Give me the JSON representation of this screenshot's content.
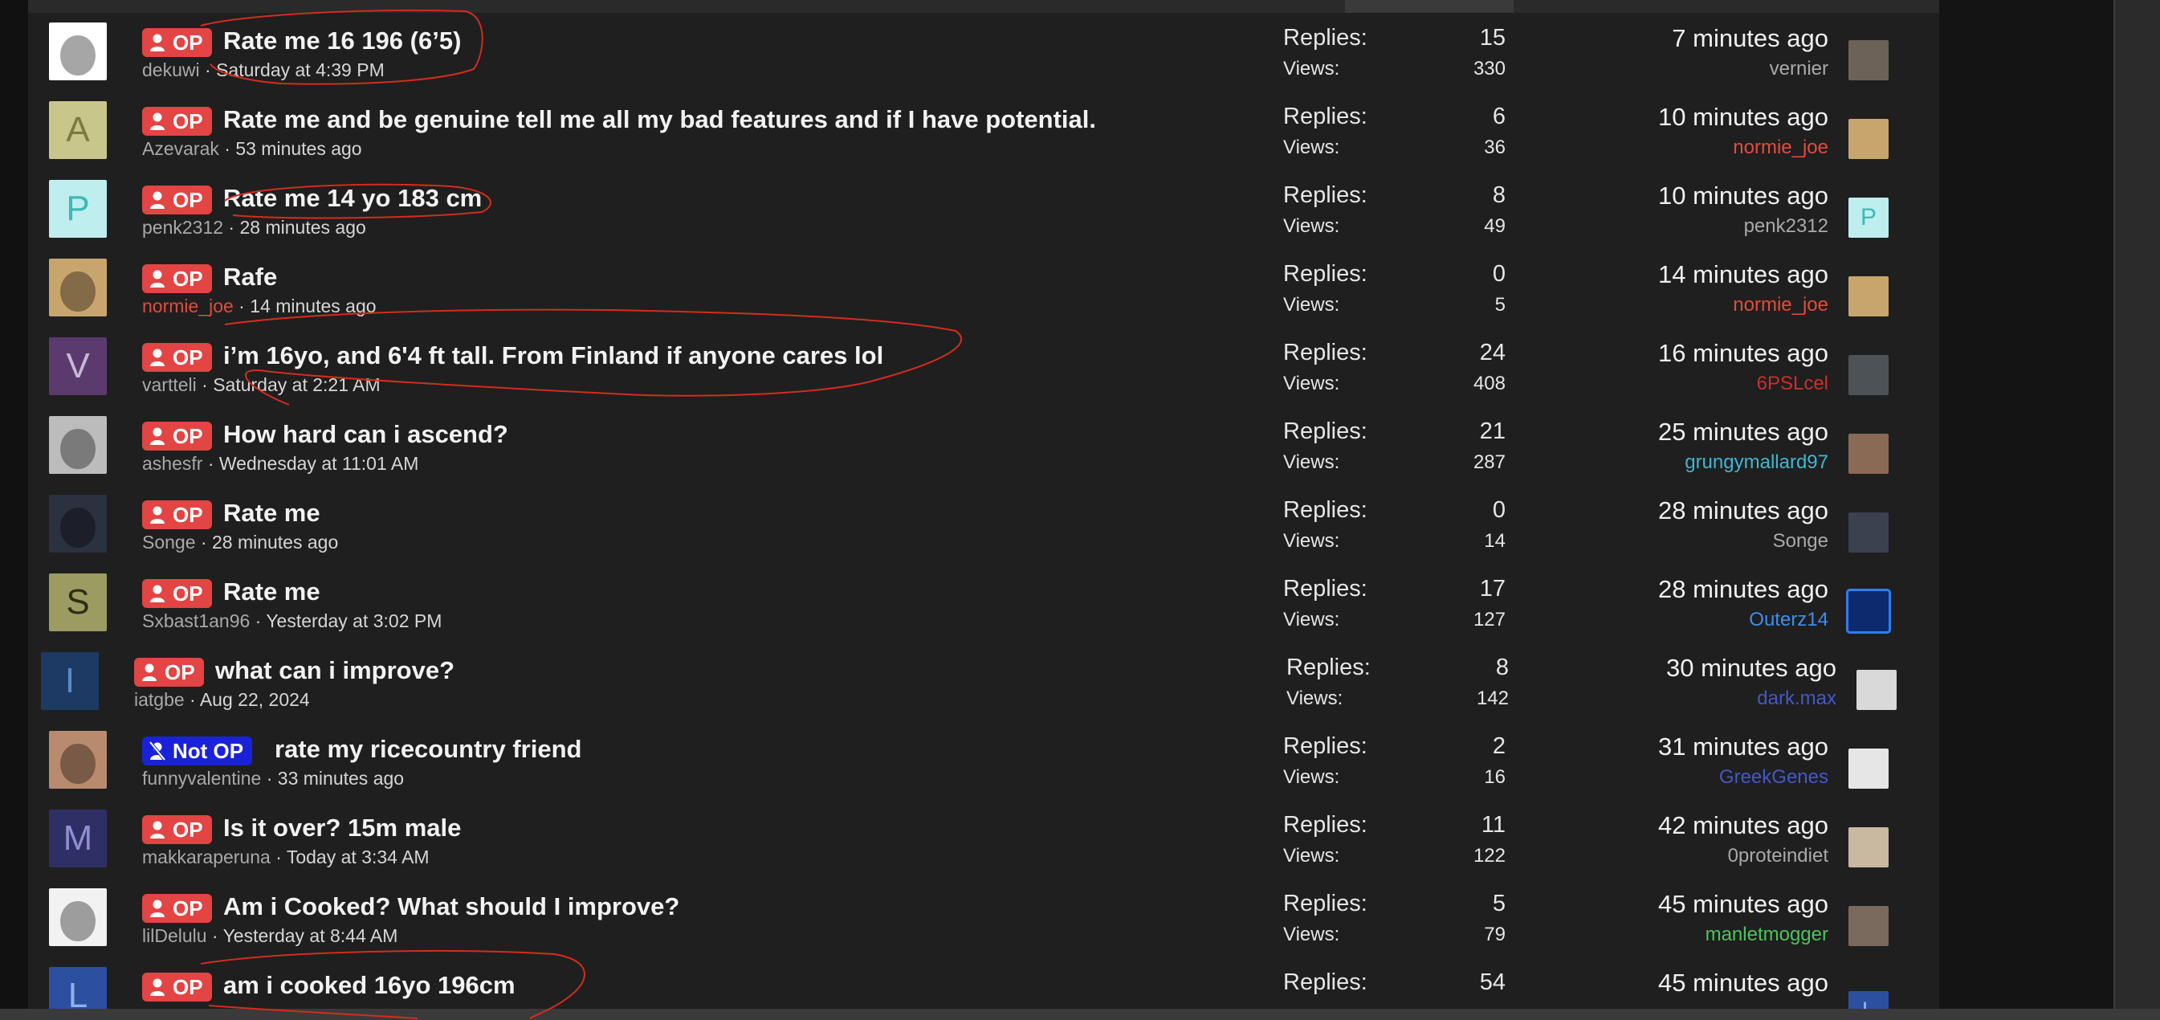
{
  "op_label": "OP",
  "not_op_label": "Not OP",
  "replies_label": "Replies:",
  "views_label": "Views:",
  "meta_separator": " · ",
  "threads": [
    {
      "title": "Rate me 16 196 (6’5)",
      "author": "dekuwi",
      "author_color": "#a9a9a9",
      "date": "Saturday at 4:39 PM",
      "replies": "15",
      "views": "330",
      "last_time": "7 minutes ago",
      "last_user": "vernier",
      "last_user_color": "#a9a9a9",
      "op": true,
      "avatar": {
        "kind": "sketch",
        "bg": "#ffffff"
      },
      "last_avatar": {
        "kind": "photo",
        "bg": "#6d6258"
      }
    },
    {
      "title": "Rate me and be genuine tell me all my bad features and if I have potential.",
      "author": "Azevarak",
      "author_color": "#a9a9a9",
      "date": "53 minutes ago",
      "replies": "6",
      "views": "36",
      "last_time": "10 minutes ago",
      "last_user": "normie_joe",
      "last_user_color": "#e34c3c",
      "op": true,
      "avatar": {
        "kind": "letter",
        "letter": "A",
        "bg": "#c9c68c",
        "fg": "#7c7a3e"
      },
      "last_avatar": {
        "kind": "photo",
        "bg": "#c9a56e"
      }
    },
    {
      "title": "Rate me 14 yo 183 cm",
      "author": "penk2312",
      "author_color": "#a9a9a9",
      "date": "28 minutes ago",
      "replies": "8",
      "views": "49",
      "last_time": "10 minutes ago",
      "last_user": "penk2312",
      "last_user_color": "#a9a9a9",
      "op": true,
      "avatar": {
        "kind": "letter",
        "letter": "P",
        "bg": "#bfeeee",
        "fg": "#3fb8b8"
      },
      "last_avatar": {
        "kind": "letter",
        "letter": "P",
        "bg": "#bfeeee",
        "fg": "#3fb8b8"
      }
    },
    {
      "title": "Rafe",
      "author": "normie_joe",
      "author_color": "#e34c3c",
      "date": "14 minutes ago",
      "replies": "0",
      "views": "5",
      "last_time": "14 minutes ago",
      "last_user": "normie_joe",
      "last_user_color": "#e34c3c",
      "op": true,
      "avatar": {
        "kind": "photo",
        "bg": "#c9a56e"
      },
      "last_avatar": {
        "kind": "photo",
        "bg": "#c9a56e"
      }
    },
    {
      "title": "i’m 16yo, and 6'4 ft tall. From Finland if anyone cares lol",
      "author": "vartteli",
      "author_color": "#a9a9a9",
      "date": "Saturday at 2:21 AM",
      "replies": "24",
      "views": "408",
      "last_time": "16 minutes ago",
      "last_user": "6PSLcel",
      "last_user_color": "#c9302c",
      "op": true,
      "avatar": {
        "kind": "letter",
        "letter": "V",
        "bg": "#5b3a6e",
        "fg": "#c9b7d6"
      },
      "last_avatar": {
        "kind": "photo",
        "bg": "#4d5256"
      }
    },
    {
      "title": "How hard can i ascend?",
      "author": "ashesfr",
      "author_color": "#a9a9a9",
      "date": "Wednesday at 11:01 AM",
      "replies": "21",
      "views": "287",
      "last_time": "25 minutes ago",
      "last_user": "grungymallard97",
      "last_user_color": "#3fb6d4",
      "op": true,
      "avatar": {
        "kind": "photo",
        "bg": "#bcbcbc"
      },
      "last_avatar": {
        "kind": "photo",
        "bg": "#8a6a55"
      }
    },
    {
      "title": "Rate me",
      "author": "Songe",
      "author_color": "#a9a9a9",
      "date": "28 minutes ago",
      "replies": "0",
      "views": "14",
      "last_time": "28 minutes ago",
      "last_user": "Songe",
      "last_user_color": "#a9a9a9",
      "op": true,
      "avatar": {
        "kind": "photo",
        "bg": "#2c3140"
      },
      "last_avatar": {
        "kind": "photo",
        "bg": "#3c4150"
      }
    },
    {
      "title": "Rate me",
      "author": "Sxbast1an96",
      "author_color": "#a9a9a9",
      "date": "Yesterday at 3:02 PM",
      "replies": "17",
      "views": "127",
      "last_time": "28 minutes ago",
      "last_user": "Outerz14",
      "last_user_color": "#3d8ef0",
      "op": true,
      "avatar": {
        "kind": "letter",
        "letter": "S",
        "bg": "#9c9c62",
        "fg": "#2e2e16"
      },
      "last_avatar": {
        "kind": "photo",
        "bg": "#0d2a6e",
        "border": "#2f7df0"
      }
    },
    {
      "title": "what can i improve?",
      "author": "iatgbe",
      "author_color": "#a9a9a9",
      "date": "Aug 22, 2024",
      "replies": "8",
      "views": "142",
      "last_time": "30 minutes ago",
      "last_user": "dark.max",
      "last_user_color": "#4458c8",
      "op": true,
      "avatar": {
        "kind": "letter",
        "letter": "I",
        "bg": "#1d3a64",
        "fg": "#5f88c8"
      },
      "last_avatar": {
        "kind": "photo",
        "bg": "#d9d9d9"
      }
    },
    {
      "title": "rate my ricecountry friend",
      "author": "funnyvalentine",
      "author_color": "#a9a9a9",
      "date": "33 minutes ago",
      "replies": "2",
      "views": "16",
      "last_time": "31 minutes ago",
      "last_user": "GreekGenes",
      "last_user_color": "#4458c8",
      "op": false,
      "avatar": {
        "kind": "photo",
        "bg": "#b98b6e"
      },
      "last_avatar": {
        "kind": "photo",
        "bg": "#e6e6e6"
      }
    },
    {
      "title": "Is it over? 15m male",
      "author": "makkaraperuna",
      "author_color": "#a9a9a9",
      "date": "Today at 3:34 AM",
      "replies": "11",
      "views": "122",
      "last_time": "42 minutes ago",
      "last_user": "0proteindiet",
      "last_user_color": "#a9a9a9",
      "op": true,
      "avatar": {
        "kind": "letter",
        "letter": "M",
        "bg": "#2f2f66",
        "fg": "#8e8ed0"
      },
      "last_avatar": {
        "kind": "photo",
        "bg": "#c8b9a0"
      }
    },
    {
      "title": "Am i Cooked? What should I improve?",
      "author": "lilDelulu",
      "author_color": "#a9a9a9",
      "date": "Yesterday at 8:44 AM",
      "replies": "5",
      "views": "79",
      "last_time": "45 minutes ago",
      "last_user": "manletmogger",
      "last_user_color": "#4cc45a",
      "op": true,
      "avatar": {
        "kind": "photo",
        "bg": "#f2f2f2"
      },
      "last_avatar": {
        "kind": "photo",
        "bg": "#7a6a5e"
      }
    },
    {
      "title": "am i cooked 16yo 196cm",
      "author": "",
      "author_color": "#a9a9a9",
      "date": "",
      "replies": "54",
      "views": "",
      "last_time": "45 minutes ago",
      "last_user": "",
      "last_user_color": "#a9a9a9",
      "op": true,
      "avatar": {
        "kind": "letter",
        "letter": "L",
        "bg": "#2c4fa0",
        "fg": "#8fb0ec"
      },
      "last_avatar": {
        "kind": "letter",
        "letter": "L",
        "bg": "#2c4fa0",
        "fg": "#8fb0ec"
      }
    }
  ]
}
